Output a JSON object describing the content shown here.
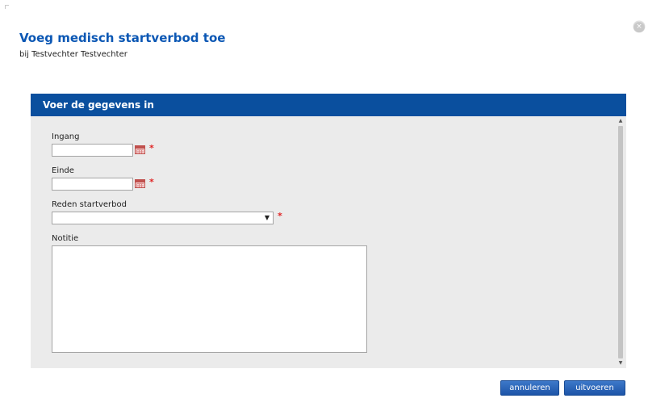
{
  "dialog": {
    "title": "Voeg medisch startverbod toe",
    "subtitle": "bij Testvechter Testvechter",
    "close_symbol": "×"
  },
  "form": {
    "header": "Voer de gegevens in",
    "fields": {
      "ingang": {
        "label": "Ingang",
        "value": "",
        "required_mark": "*"
      },
      "einde": {
        "label": "Einde",
        "value": "",
        "required_mark": "*"
      },
      "reden": {
        "label": "Reden startverbod",
        "selected": "",
        "arrow": "▼",
        "required_mark": "*"
      },
      "notitie": {
        "label": "Notitie",
        "value": ""
      }
    }
  },
  "buttons": {
    "cancel_label": "annuleren",
    "submit_label": "uitvoeren"
  },
  "icons": {
    "close": "close-icon",
    "calendar": "calendar-icon",
    "dropdown": "chevron-down-icon"
  },
  "colors": {
    "title": "#0b57b4",
    "header_bar": "#0a4f9e",
    "panel_bg": "#ebebeb",
    "required": "#e02424",
    "button": "#2a63b5"
  }
}
